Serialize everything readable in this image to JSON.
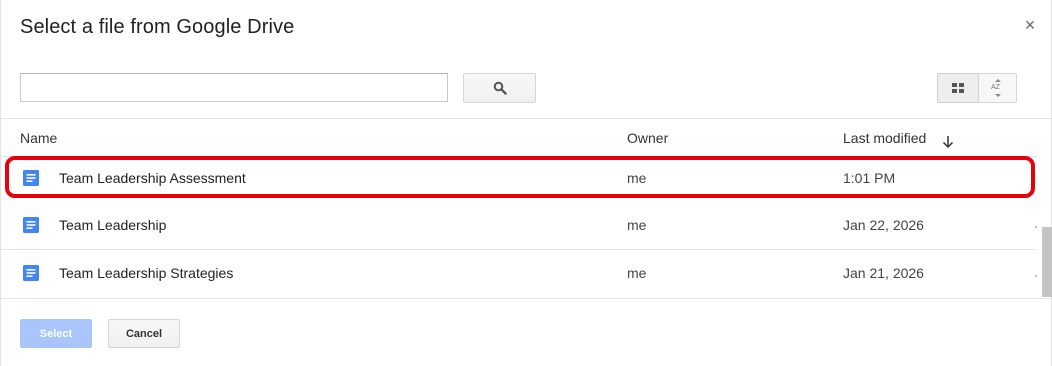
{
  "dialog": {
    "title": "Select a file from Google Drive",
    "close_label": "×"
  },
  "search": {
    "value": "",
    "placeholder": "",
    "button_icon": "search-icon"
  },
  "toolbar": {
    "view_toggle_icon": "grid-view-icon",
    "sort_toggle_icon": "sort-az-icon",
    "sort_toggle_label": "AZ"
  },
  "table": {
    "columns": {
      "name": "Name",
      "owner": "Owner",
      "modified": "Last modified"
    },
    "sort_icon": "arrow-down-icon",
    "rows": [
      {
        "name": "Team Leadership Assessment",
        "owner": "me",
        "modified": "1:01 PM",
        "icon": "google-docs-icon",
        "highlighted": true
      },
      {
        "name": "Team Leadership",
        "owner": "me",
        "modified": "Jan 22, 2026",
        "icon": "google-docs-icon",
        "highlighted": false
      },
      {
        "name": "Team Leadership Strategies",
        "owner": "me",
        "modified": "Jan 21, 2026",
        "icon": "google-docs-icon",
        "highlighted": false
      }
    ]
  },
  "footer": {
    "select_label": "Select",
    "cancel_label": "Cancel"
  },
  "colors": {
    "doc_icon": "#4285f4",
    "highlight": "#e8000b",
    "select_button": "#a9c5fb"
  }
}
